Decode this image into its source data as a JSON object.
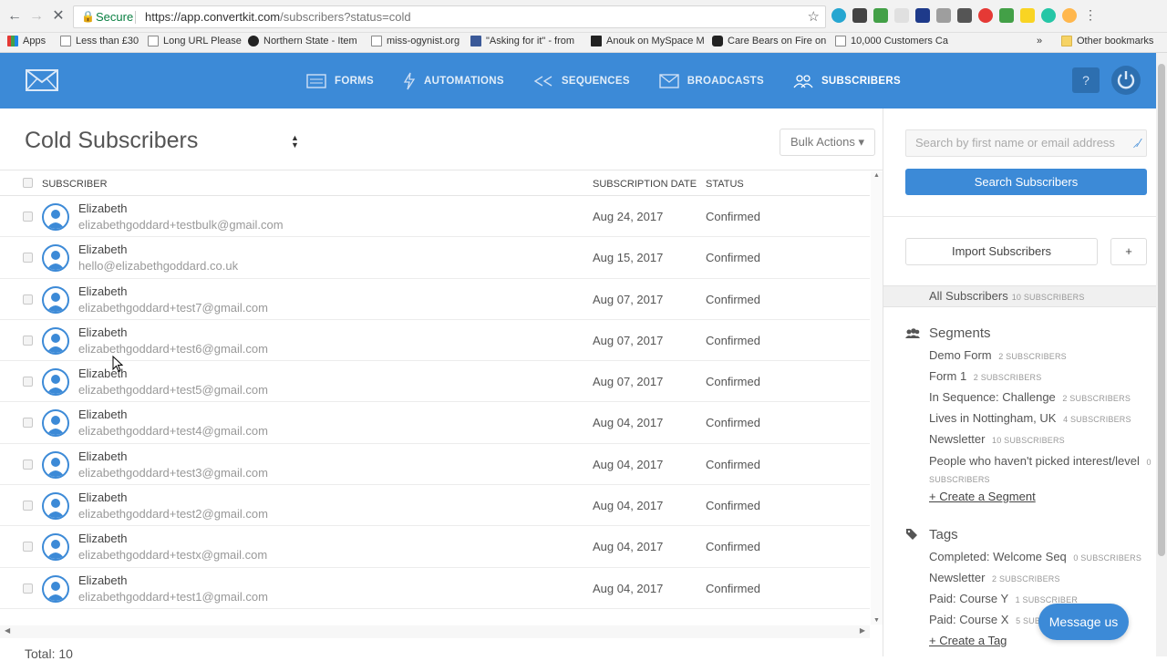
{
  "browser": {
    "secure_label": "Secure",
    "url_host": "https://app.convertkit.com",
    "url_path": "/subscribers?status=cold",
    "bookmarks": [
      "Apps",
      "Less than £30",
      "Long URL Please",
      "Northern State - Item",
      "miss-ogynist.org",
      "\"Asking for it\" - from",
      "Anouk on MySpace M",
      "Care Bears on Fire on",
      "10,000 Customers Ca"
    ],
    "more_label": "»",
    "other_bookmarks": "Other bookmarks"
  },
  "header": {
    "nav": [
      {
        "label": "FORMS",
        "icon": "forms-icon"
      },
      {
        "label": "AUTOMATIONS",
        "icon": "lightning-icon"
      },
      {
        "label": "SEQUENCES",
        "icon": "sequences-icon"
      },
      {
        "label": "BROADCASTS",
        "icon": "envelope-icon"
      },
      {
        "label": "SUBSCRIBERS",
        "icon": "people-icon",
        "active": true
      }
    ],
    "help_label": "?"
  },
  "main": {
    "title": "Cold Subscribers",
    "bulk_actions_label": "Bulk Actions ▾",
    "columns": {
      "subscriber": "SUBSCRIBER",
      "date": "SUBSCRIPTION DATE",
      "status": "STATUS"
    },
    "rows": [
      {
        "name": "Elizabeth",
        "email": "elizabethgoddard+testbulk@gmail.com",
        "date": "Aug 24, 2017",
        "status": "Confirmed"
      },
      {
        "name": "Elizabeth",
        "email": "hello@elizabethgoddard.co.uk",
        "date": "Aug 15, 2017",
        "status": "Confirmed"
      },
      {
        "name": "Elizabeth",
        "email": "elizabethgoddard+test7@gmail.com",
        "date": "Aug 07, 2017",
        "status": "Confirmed"
      },
      {
        "name": "Elizabeth",
        "email": "elizabethgoddard+test6@gmail.com",
        "date": "Aug 07, 2017",
        "status": "Confirmed"
      },
      {
        "name": "Elizabeth",
        "email": "elizabethgoddard+test5@gmail.com",
        "date": "Aug 07, 2017",
        "status": "Confirmed"
      },
      {
        "name": "Elizabeth",
        "email": "elizabethgoddard+test4@gmail.com",
        "date": "Aug 04, 2017",
        "status": "Confirmed"
      },
      {
        "name": "Elizabeth",
        "email": "elizabethgoddard+test3@gmail.com",
        "date": "Aug 04, 2017",
        "status": "Confirmed"
      },
      {
        "name": "Elizabeth",
        "email": "elizabethgoddard+test2@gmail.com",
        "date": "Aug 04, 2017",
        "status": "Confirmed"
      },
      {
        "name": "Elizabeth",
        "email": "elizabethgoddard+testx@gmail.com",
        "date": "Aug 04, 2017",
        "status": "Confirmed"
      },
      {
        "name": "Elizabeth",
        "email": "elizabethgoddard+test1@gmail.com",
        "date": "Aug 04, 2017",
        "status": "Confirmed"
      }
    ],
    "total_label": "Total: 10"
  },
  "sidebar": {
    "search_placeholder": "Search by first name or email address",
    "search_button": "Search Subscribers",
    "import_button": "Import Subscribers",
    "plus_button": "+",
    "all_subscribers": {
      "label": "All Subscribers",
      "count": "10 SUBSCRIBERS"
    },
    "segments_title": "Segments",
    "segments": [
      {
        "label": "Demo Form",
        "count": "2 SUBSCRIBERS"
      },
      {
        "label": "Form 1",
        "count": "2 SUBSCRIBERS"
      },
      {
        "label": "In Sequence: Challenge",
        "count": "2 SUBSCRIBERS"
      },
      {
        "label": "Lives in Nottingham, UK",
        "count": "4 SUBSCRIBERS"
      },
      {
        "label": "Newsletter",
        "count": "10 SUBSCRIBERS"
      },
      {
        "label": "People who haven't picked interest/level",
        "count": "0 SUBSCRIBERS"
      }
    ],
    "create_segment": "+ Create a Segment",
    "tags_title": "Tags",
    "tags": [
      {
        "label": "Completed: Welcome Seq",
        "count": "0 SUBSCRIBERS"
      },
      {
        "label": "Newsletter",
        "count": "2 SUBSCRIBERS"
      },
      {
        "label": "Paid: Course Y",
        "count": "1 SUBSCRIBER"
      },
      {
        "label": "Paid: Course X",
        "count": "5 SUBSCRIBERS"
      }
    ],
    "create_tag": "+ Create a Tag"
  },
  "chat": {
    "label": "Message us"
  },
  "colors": {
    "brand": "#3c8ad7",
    "brand_dark": "#2d6fb0"
  }
}
